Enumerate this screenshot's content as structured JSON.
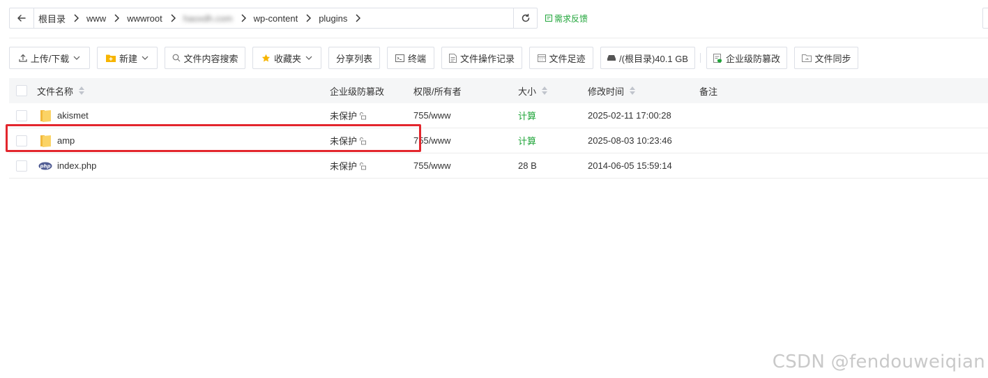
{
  "breadcrumb": {
    "items": [
      "根目录",
      "www",
      "wwwroot",
      "haoxdh.com",
      "wp-content",
      "plugins"
    ]
  },
  "feedback_label": "需求反馈",
  "toolbar": {
    "upload": "上传/下载",
    "new": "新建",
    "search": "文件内容搜索",
    "favorites": "收藏夹",
    "share_list": "分享列表",
    "terminal": "终端",
    "op_log": "文件操作记录",
    "footprint": "文件足迹",
    "disk": "/(根目录)40.1 GB",
    "tamper": "企业级防篡改",
    "sync": "文件同步"
  },
  "table": {
    "headers": {
      "name": "文件名称",
      "protect": "企业级防篡改",
      "perm": "权限/所有者",
      "size": "大小",
      "mtime": "修改时间",
      "note": "备注"
    },
    "rows": [
      {
        "name": "akismet",
        "type": "folder",
        "protect": "未保护",
        "perm": "755/www",
        "size": "计算",
        "mtime": "2025-02-11 17:00:28",
        "note": ""
      },
      {
        "name": "amp",
        "type": "folder",
        "protect": "未保护",
        "perm": "755/www",
        "size": "计算",
        "mtime": "2025-08-03 10:23:46",
        "note": ""
      },
      {
        "name": "index.php",
        "type": "php",
        "protect": "未保护",
        "perm": "755/www",
        "size": "28 B",
        "mtime": "2014-06-05 15:59:14",
        "note": ""
      }
    ]
  },
  "watermark": "CSDN @fendouweiqian",
  "colors": {
    "accent_green": "#20a53a",
    "highlight_red": "#e3262d",
    "folder_yellow": "#f7c948"
  }
}
